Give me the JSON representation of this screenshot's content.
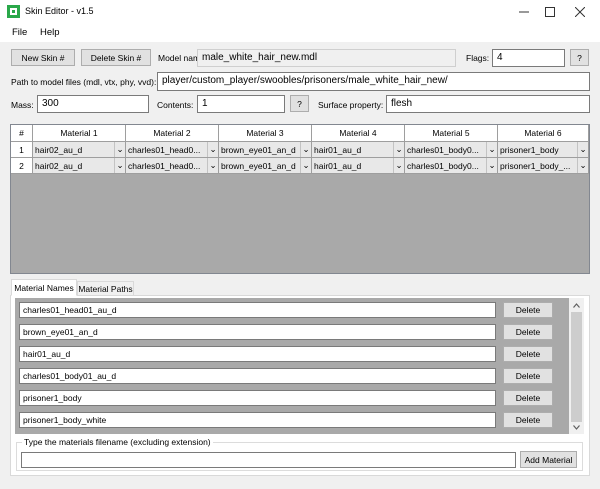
{
  "window": {
    "title": "Skin Editor - v1.5"
  },
  "menu": [
    "File",
    "Help"
  ],
  "toolbar": {
    "new_skin": "New Skin #",
    "delete_skin": "Delete Skin #",
    "model_name_label": "Model name:",
    "model_name_value": "male_white_hair_new.mdl",
    "flags_label": "Flags:",
    "flags_value": "4",
    "help_label": "?"
  },
  "paths": {
    "label": "Path to model files (mdl, vtx, phy, vvd):",
    "value": "player/custom_player/swoobles/prisoners/male_white_hair_new/"
  },
  "props": {
    "mass_label": "Mass:",
    "mass_value": "300",
    "contents_label": "Contents:",
    "contents_value": "1",
    "help_label": "?",
    "surface_label": "Surface property:",
    "surface_value": "flesh"
  },
  "grid": {
    "headers": [
      "#",
      "Material 1",
      "Material 2",
      "Material 3",
      "Material 4",
      "Material 5",
      "Material 6"
    ],
    "rows": [
      [
        "1",
        "hair02_au_d",
        "charles01_head0...",
        "brown_eye01_an_d",
        "hair01_au_d",
        "charles01_body0...",
        "prisoner1_body"
      ],
      [
        "2",
        "hair02_au_d",
        "charles01_head0...",
        "brown_eye01_an_d",
        "hair01_au_d",
        "charles01_body0...",
        "prisoner1_body_..."
      ]
    ]
  },
  "tabs": [
    "Material Names",
    "Material Paths"
  ],
  "materials": [
    "charles01_head01_au_d",
    "brown_eye01_an_d",
    "hair01_au_d",
    "charles01_body01_au_d",
    "prisoner1_body",
    "prisoner1_body_white"
  ],
  "delete_label": "Delete",
  "add": {
    "group_label": "Type the materials filename (excluding extension)",
    "input_value": "",
    "button_label": "Add Material"
  },
  "colors": {
    "icon_green": "#2aa84a",
    "grid_bg": "#a9a9a9"
  }
}
